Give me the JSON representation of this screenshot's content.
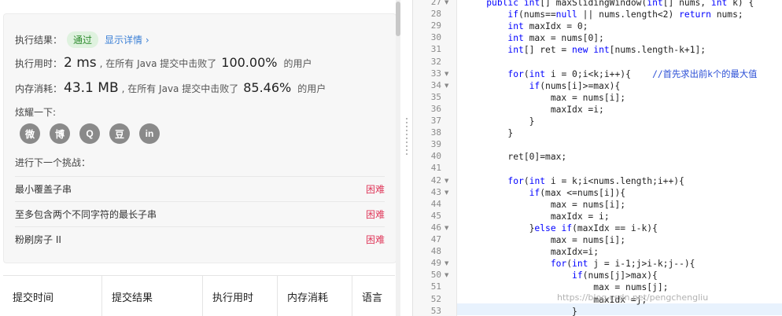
{
  "result": {
    "label": "执行结果：",
    "status": "通过",
    "detail_link": "显示详情 ›"
  },
  "runtime": {
    "label": "执行用时：",
    "value": "2 ms",
    "mid": ", 在所有 Java 提交中击败了",
    "percent": "100.00%",
    "suffix": "的用户"
  },
  "memory": {
    "label": "内存消耗：",
    "value": "43.1 MB",
    "mid": ", 在所有 Java 提交中击败了",
    "percent": "85.46%",
    "suffix": "的用户"
  },
  "share": {
    "label": "炫耀一下:",
    "icons": [
      "wechat-icon",
      "weibo-icon",
      "qq-icon",
      "douban-icon",
      "linkedin-icon"
    ],
    "glyphs": [
      "微",
      "博",
      "Q",
      "豆",
      "in"
    ]
  },
  "next_challenge": {
    "label": "进行下一个挑战：",
    "items": [
      {
        "name": "最小覆盖子串",
        "difficulty": "困难"
      },
      {
        "name": "至多包含两个不同字符的最长子串",
        "difficulty": "困难"
      },
      {
        "name": "粉刷房子 II",
        "difficulty": "困难"
      }
    ]
  },
  "submissions_table": {
    "headers": [
      "提交时间",
      "提交结果",
      "执行用时",
      "内存消耗",
      "语言"
    ]
  },
  "code": {
    "lines": [
      {
        "n": "27",
        "fold": true,
        "text": "    public int[] maxSlidingWindow(int[] nums, int k) {"
      },
      {
        "n": "28",
        "fold": false,
        "text": "        if(nums==null || nums.length<2) return nums;"
      },
      {
        "n": "29",
        "fold": false,
        "text": "        int maxIdx = 0;"
      },
      {
        "n": "30",
        "fold": false,
        "text": "        int max = nums[0];"
      },
      {
        "n": "31",
        "fold": false,
        "text": "        int[] ret = new int[nums.length-k+1];"
      },
      {
        "n": "32",
        "fold": false,
        "text": ""
      },
      {
        "n": "33",
        "fold": true,
        "text": "        for(int i = 0;i<k;i++){    //首先求出前k个的最大值"
      },
      {
        "n": "34",
        "fold": true,
        "text": "            if(nums[i]>=max){"
      },
      {
        "n": "35",
        "fold": false,
        "text": "                max = nums[i];"
      },
      {
        "n": "36",
        "fold": false,
        "text": "                maxIdx =i;"
      },
      {
        "n": "37",
        "fold": false,
        "text": "            }"
      },
      {
        "n": "38",
        "fold": false,
        "text": "        }"
      },
      {
        "n": "39",
        "fold": false,
        "text": ""
      },
      {
        "n": "40",
        "fold": false,
        "text": "        ret[0]=max;"
      },
      {
        "n": "41",
        "fold": false,
        "text": ""
      },
      {
        "n": "42",
        "fold": true,
        "text": "        for(int i = k;i<nums.length;i++){"
      },
      {
        "n": "43",
        "fold": true,
        "text": "            if(max <=nums[i]){"
      },
      {
        "n": "44",
        "fold": false,
        "text": "                max = nums[i];"
      },
      {
        "n": "45",
        "fold": false,
        "text": "                maxIdx = i;"
      },
      {
        "n": "46",
        "fold": true,
        "text": "            }else if(maxIdx == i-k){"
      },
      {
        "n": "47",
        "fold": false,
        "text": "                max = nums[i];"
      },
      {
        "n": "48",
        "fold": false,
        "text": "                maxIdx=i;"
      },
      {
        "n": "49",
        "fold": true,
        "text": "                for(int j = i-1;j>i-k;j--){"
      },
      {
        "n": "50",
        "fold": true,
        "text": "                    if(nums[j]>max){"
      },
      {
        "n": "51",
        "fold": false,
        "text": "                        max = nums[j];"
      },
      {
        "n": "52",
        "fold": false,
        "text": "                        maxIdx =j;"
      },
      {
        "n": "53",
        "fold": false,
        "text": "                    }"
      }
    ]
  },
  "watermark": "https://blog.csdn.net/pengchengliu",
  "colors": {
    "accent_link": "#3a7fd6",
    "pass_green": "#2e8b2e",
    "hard_red": "#e03a5c",
    "keyword_blue": "#0000ff",
    "comment_blue": "#2b4fd6"
  }
}
